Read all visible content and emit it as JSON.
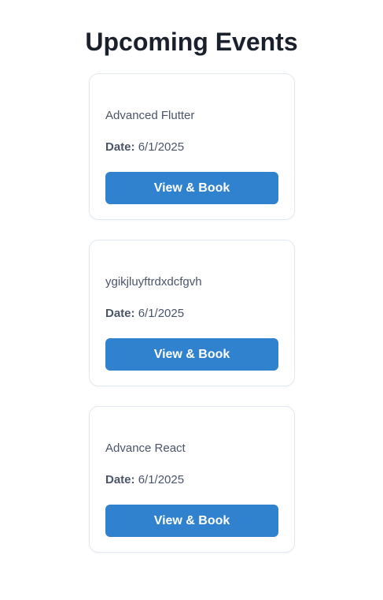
{
  "page": {
    "title": "Upcoming Events"
  },
  "events": [
    {
      "name": "Advanced Flutter",
      "date_label": "Date:",
      "date": "6/1/2025",
      "button_label": "View & Book"
    },
    {
      "name": "ygikjluyftrdxdcfgvh",
      "date_label": "Date:",
      "date": "6/1/2025",
      "button_label": "View & Book"
    },
    {
      "name": "Advance React",
      "date_label": "Date:",
      "date": "6/1/2025",
      "button_label": "View & Book"
    }
  ],
  "colors": {
    "accent": "#3182ce",
    "heading": "#1a202c",
    "text": "#4a5568",
    "card_border": "#e2e8f0"
  }
}
